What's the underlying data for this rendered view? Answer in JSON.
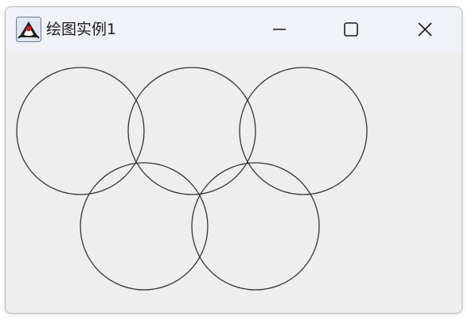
{
  "window": {
    "title": "绘图实例1",
    "app_icon": "java-duke-icon"
  },
  "title_controls": {
    "minimize_icon": "minimize-icon",
    "maximize_icon": "maximize-icon",
    "close_icon": "close-icon"
  },
  "drawing": {
    "shape_count": 5,
    "stroke_color": "#333333",
    "background_color": "#eeeeee"
  }
}
